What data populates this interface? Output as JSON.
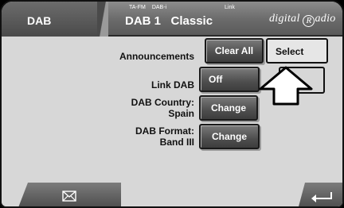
{
  "header": {
    "tab_label": "DAB",
    "source_tags": [
      "TA-FM",
      "DAB-i"
    ],
    "link_tag": "Link",
    "station": "DAB 1   Classic",
    "logo_prefix": "digital ",
    "logo_mark": "R",
    "logo_suffix": "adio"
  },
  "settings": {
    "announcements": {
      "label": "Announcements",
      "clear_all": "Clear All",
      "select": "Select"
    },
    "link_dab": {
      "label": "Link DAB",
      "value": "Off"
    },
    "country": {
      "label_line1": "DAB Country:",
      "label_line2": "Spain",
      "action": "Change"
    },
    "format": {
      "label_line1": "DAB Format:",
      "label_line2": "Band III",
      "action": "Change"
    }
  },
  "icons": {
    "mail": "envelope-icon",
    "back": "return-arrow-icon",
    "pointer": "up-arrow-pointer-icon"
  },
  "colors": {
    "background": "#d7d7d7",
    "header": "#6a6a6a",
    "button": "#4e4e4e",
    "select_button": "#e6e6e6"
  }
}
